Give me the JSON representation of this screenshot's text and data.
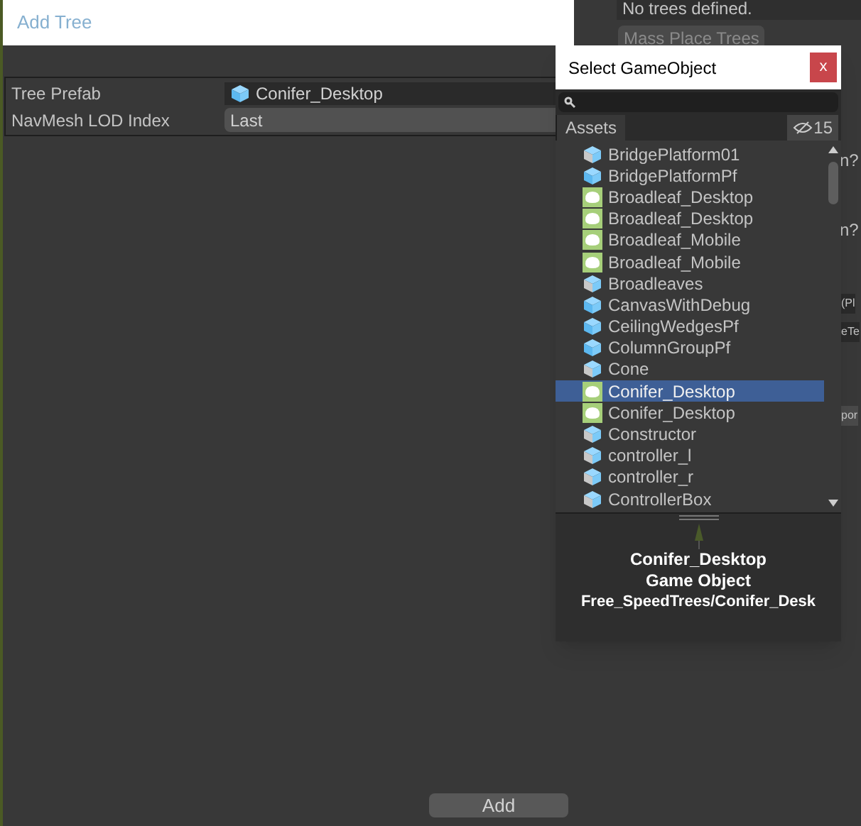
{
  "background": {
    "message": "No trees defined.",
    "mass_place_button": "Mass Place Trees",
    "fragments": [
      "n?",
      "n?",
      "(Pl",
      "eTe",
      "por"
    ]
  },
  "add_tree_window": {
    "title": "Add Tree",
    "fields": [
      {
        "kind": "object",
        "label": "Tree Prefab",
        "value": "Conifer_Desktop"
      },
      {
        "kind": "dropdown",
        "label": "NavMesh LOD Index",
        "value": "Last"
      }
    ],
    "add_button": "Add"
  },
  "picker": {
    "title": "Select GameObject",
    "close": "x",
    "tab": "Assets",
    "hidden_count": "15",
    "items": [
      {
        "kind": "model",
        "label": "BridgePlatform01",
        "selected": false
      },
      {
        "kind": "prefab",
        "label": "BridgePlatformPf",
        "selected": false
      },
      {
        "kind": "tree",
        "label": "Broadleaf_Desktop",
        "selected": false
      },
      {
        "kind": "tree",
        "label": "Broadleaf_Desktop",
        "selected": false
      },
      {
        "kind": "tree",
        "label": "Broadleaf_Mobile",
        "selected": false
      },
      {
        "kind": "tree",
        "label": "Broadleaf_Mobile",
        "selected": false
      },
      {
        "kind": "model",
        "label": "Broadleaves",
        "selected": false
      },
      {
        "kind": "prefab",
        "label": "CanvasWithDebug",
        "selected": false
      },
      {
        "kind": "prefab",
        "label": "CeilingWedgesPf",
        "selected": false
      },
      {
        "kind": "prefab",
        "label": "ColumnGroupPf",
        "selected": false
      },
      {
        "kind": "model",
        "label": "Cone",
        "selected": false
      },
      {
        "kind": "tree",
        "label": "Conifer_Desktop",
        "selected": true
      },
      {
        "kind": "tree",
        "label": "Conifer_Desktop",
        "selected": false
      },
      {
        "kind": "model",
        "label": "Constructor",
        "selected": false
      },
      {
        "kind": "model",
        "label": "controller_l",
        "selected": false
      },
      {
        "kind": "model",
        "label": "controller_r",
        "selected": false
      },
      {
        "kind": "model",
        "label": "ControllerBox",
        "selected": false
      }
    ],
    "preview": {
      "name": "Conifer_Desktop",
      "type": "Game Object",
      "path": "Free_SpeedTrees/Conifer_Desk"
    }
  }
}
